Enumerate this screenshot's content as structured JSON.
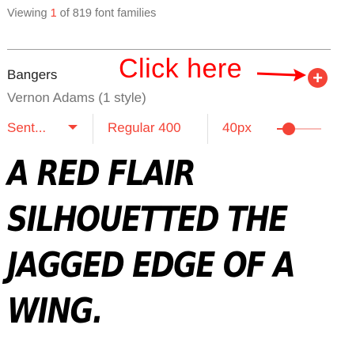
{
  "header": {
    "viewing_prefix": "Viewing",
    "viewing_current": "1",
    "viewing_suffix": "of 819 font families"
  },
  "font_card": {
    "name": "Bangers",
    "author": "Vernon Adams (1 style)",
    "add_icon": "plus-icon",
    "add_symbol": "+"
  },
  "annotation": {
    "text": "Click here"
  },
  "controls": {
    "preview_type": "Sent...",
    "style": "Regular 400",
    "size": "40px",
    "size_slider_level": 0.3
  },
  "preview": {
    "text": "A red flair silhouetted the jagged edge of a wing."
  },
  "colors": {
    "accent": "#f44336",
    "annotation": "#ff0000",
    "muted_text": "#757575",
    "primary_text": "#212121"
  }
}
